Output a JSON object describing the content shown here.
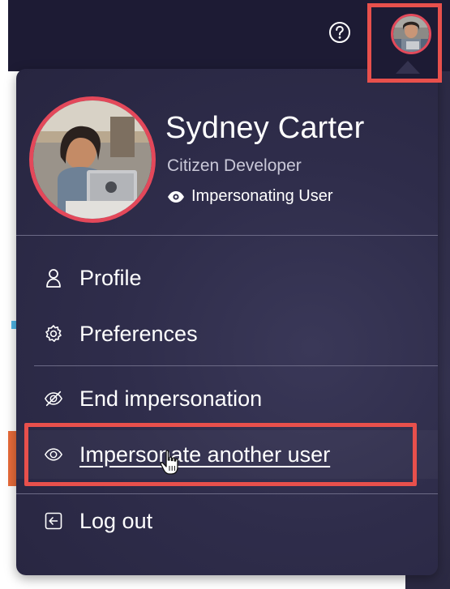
{
  "header": {
    "help_label": "?"
  },
  "user": {
    "name": "Sydney Carter",
    "role": "Citizen Developer",
    "impersonation_status": "Impersonating User",
    "presence_status_color": "#3ed15a"
  },
  "menu": {
    "items": [
      {
        "label": "Profile",
        "icon": "person-icon"
      },
      {
        "label": "Preferences",
        "icon": "gear-icon"
      },
      {
        "label": "End impersonation",
        "icon": "eye-slash-icon"
      },
      {
        "label": "Impersonate another user",
        "icon": "eye-icon"
      },
      {
        "label": "Log out",
        "icon": "logout-icon"
      }
    ]
  },
  "colors": {
    "highlight": "#e8504c",
    "panel_background": "#2f2d4b",
    "header_background": "#1d1b34",
    "avatar_ring": "#e3485a"
  }
}
